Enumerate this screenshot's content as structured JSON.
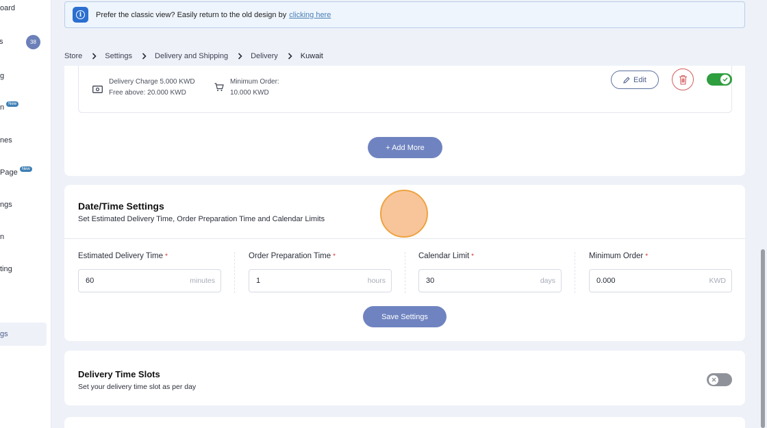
{
  "sidebar": {
    "items": [
      {
        "label": "oard"
      },
      {
        "label": "s"
      },
      {
        "label": "g"
      },
      {
        "label": "n"
      },
      {
        "label": "nes"
      },
      {
        "label": "Page"
      },
      {
        "label": "ngs"
      },
      {
        "label": "n"
      },
      {
        "label": "ting"
      },
      {
        "label": "gs"
      }
    ],
    "badge_count": "38",
    "new_label": "New"
  },
  "banner": {
    "text": "Prefer the classic view? Easily return to the old design by",
    "link": "clicking here"
  },
  "breadcrumb": [
    "Store",
    "Settings",
    "Delivery and Shipping",
    "Delivery",
    "Kuwait"
  ],
  "rule": {
    "charge_line1": "Delivery Charge 5.000 KWD",
    "charge_line2": "Free above: 20.000 KWD",
    "min_line1": "Minimum Order:",
    "min_line2": "10.000 KWD",
    "edit_label": "Edit",
    "enabled": true
  },
  "add_more_label": "+ Add More",
  "datetime": {
    "title": "Date/Time Settings",
    "subtitle": "Set Estimated Delivery Time, Order Preparation Time and Calendar Limits",
    "required_mark": "*",
    "fields": [
      {
        "label": "Estimated Delivery Time",
        "value": "60",
        "unit": "minutes"
      },
      {
        "label": "Order Preparation Time",
        "value": "1",
        "unit": "hours"
      },
      {
        "label": "Calendar Limit",
        "value": "30",
        "unit": "days"
      },
      {
        "label": "Minimum Order",
        "value": "0.000",
        "unit": "KWD"
      }
    ],
    "save_label": "Save Settings"
  },
  "slots": {
    "title": "Delivery Time Slots",
    "subtitle": "Set your delivery time slot as per day",
    "enabled": false
  },
  "colors": {
    "accent": "#6f83c0",
    "toggle_on": "#2e9e3e",
    "toggle_off": "#8f9299",
    "required": "#dd3333"
  }
}
